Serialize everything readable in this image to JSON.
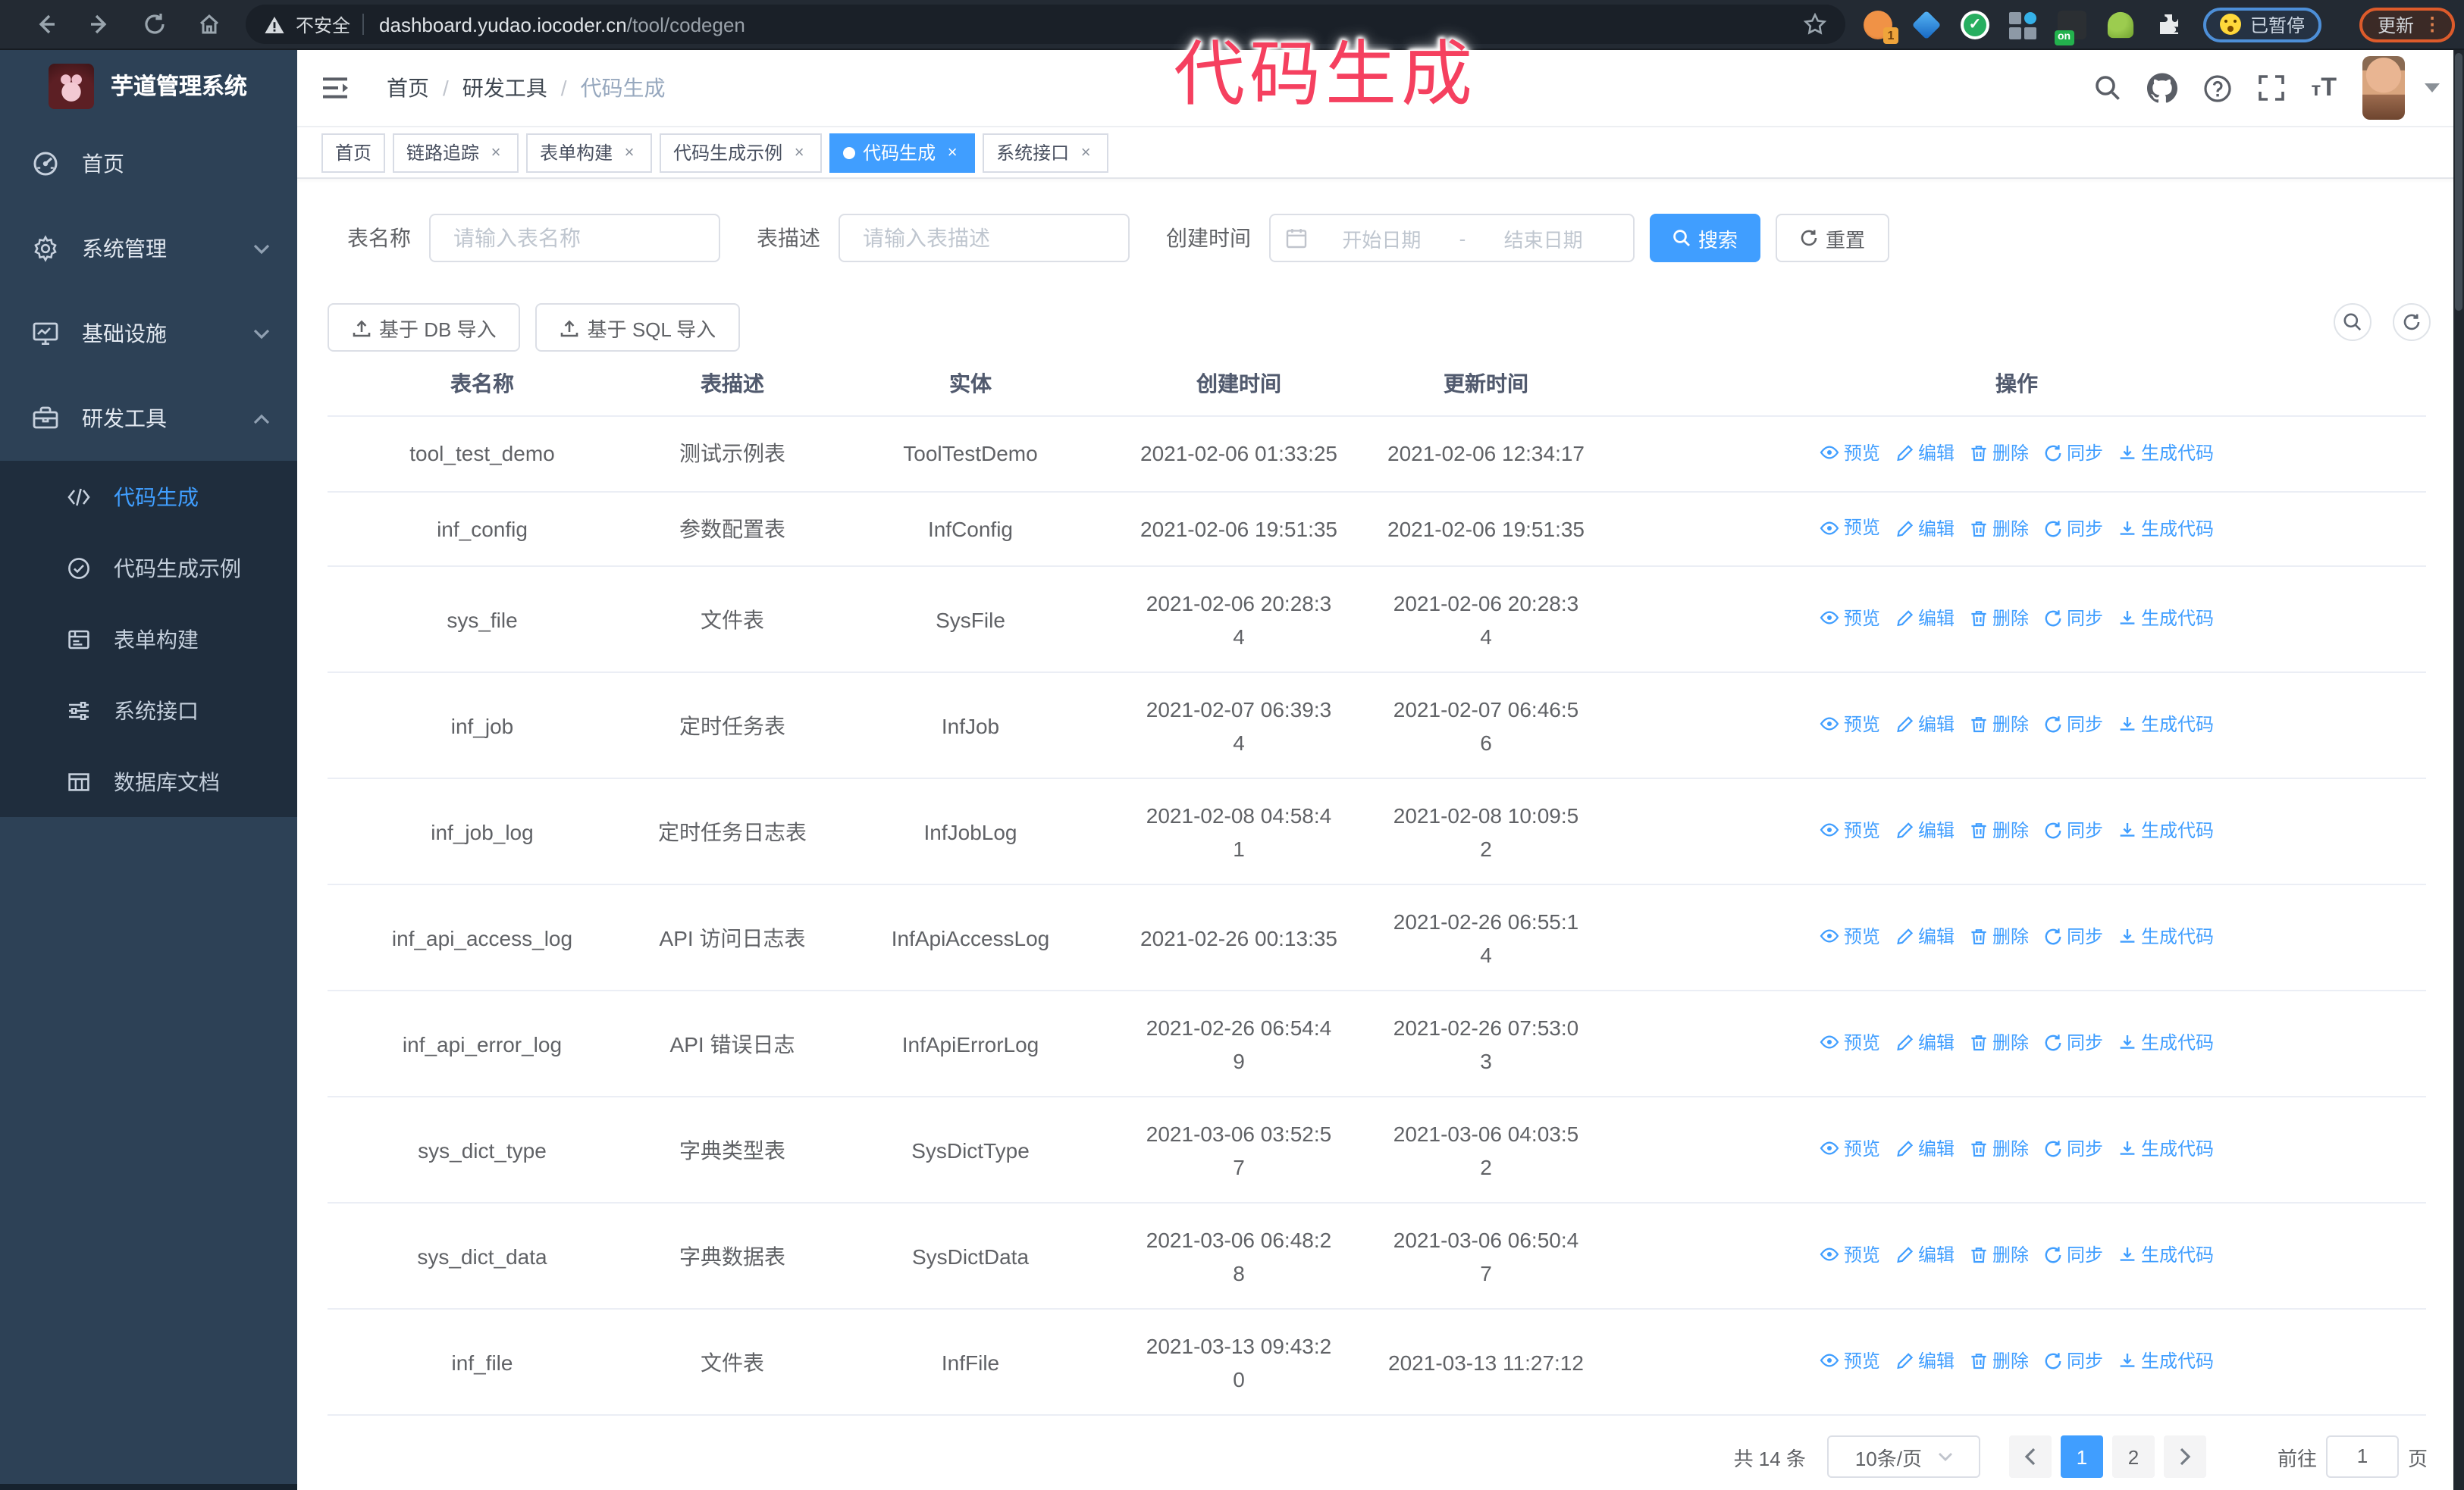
{
  "chrome": {
    "security_label": "不安全",
    "url_host": "dashboard.yudao.iocoder.cn",
    "url_path": "/tool/codegen",
    "paused_label": "已暂停",
    "update_label": "更新"
  },
  "annotation": "代码生成",
  "sidebar": {
    "logo_title": "芋道管理系统",
    "items": [
      {
        "label": "首页"
      },
      {
        "label": "系统管理"
      },
      {
        "label": "基础设施"
      },
      {
        "label": "研发工具"
      }
    ],
    "subitems": [
      {
        "label": "代码生成",
        "active": true
      },
      {
        "label": "代码生成示例"
      },
      {
        "label": "表单构建"
      },
      {
        "label": "系统接口"
      },
      {
        "label": "数据库文档"
      }
    ]
  },
  "navbar": {
    "breadcrumb": [
      "首页",
      "研发工具",
      "代码生成"
    ]
  },
  "tags": [
    {
      "label": "首页",
      "closable": false,
      "active": false
    },
    {
      "label": "链路追踪",
      "closable": true,
      "active": false
    },
    {
      "label": "表单构建",
      "closable": true,
      "active": false
    },
    {
      "label": "代码生成示例",
      "closable": true,
      "active": false
    },
    {
      "label": "代码生成",
      "closable": true,
      "active": true
    },
    {
      "label": "系统接口",
      "closable": true,
      "active": false
    }
  ],
  "filters": {
    "name_label": "表名称",
    "name_placeholder": "请输入表名称",
    "desc_label": "表描述",
    "desc_placeholder": "请输入表描述",
    "time_label": "创建时间",
    "start_placeholder": "开始日期",
    "range_separator": "-",
    "end_placeholder": "结束日期",
    "search_label": "搜索",
    "reset_label": "重置",
    "import_db_label": "基于 DB 导入",
    "import_sql_label": "基于 SQL 导入"
  },
  "table": {
    "columns": [
      "表名称",
      "表描述",
      "实体",
      "创建时间",
      "更新时间",
      "操作"
    ],
    "op_labels": {
      "preview": "预览",
      "edit": "编辑",
      "delete": "删除",
      "sync": "同步",
      "generate": "生成代码"
    },
    "rows": [
      {
        "name": "tool_test_demo",
        "desc": "测试示例表",
        "entity": "ToolTestDemo",
        "created": "2021-02-06 01:33:25",
        "updated": "2021-02-06 12:34:17"
      },
      {
        "name": "inf_config",
        "desc": "参数配置表",
        "entity": "InfConfig",
        "created": "2021-02-06 19:51:35",
        "updated": "2021-02-06 19:51:35"
      },
      {
        "name": "sys_file",
        "desc": "文件表",
        "entity": "SysFile",
        "created": "2021-02-06 20:28:3\n4",
        "updated": "2021-02-06 20:28:3\n4"
      },
      {
        "name": "inf_job",
        "desc": "定时任务表",
        "entity": "InfJob",
        "created": "2021-02-07 06:39:3\n4",
        "updated": "2021-02-07 06:46:5\n6"
      },
      {
        "name": "inf_job_log",
        "desc": "定时任务日志表",
        "entity": "InfJobLog",
        "created": "2021-02-08 04:58:4\n1",
        "updated": "2021-02-08 10:09:5\n2"
      },
      {
        "name": "inf_api_access_log",
        "desc": "API 访问日志表",
        "entity": "InfApiAccessLog",
        "created": "2021-02-26 00:13:35",
        "updated": "2021-02-26 06:55:1\n4"
      },
      {
        "name": "inf_api_error_log",
        "desc": "API 错误日志",
        "entity": "InfApiErrorLog",
        "created": "2021-02-26 06:54:4\n9",
        "updated": "2021-02-26 07:53:0\n3"
      },
      {
        "name": "sys_dict_type",
        "desc": "字典类型表",
        "entity": "SysDictType",
        "created": "2021-03-06 03:52:5\n7",
        "updated": "2021-03-06 04:03:5\n2"
      },
      {
        "name": "sys_dict_data",
        "desc": "字典数据表",
        "entity": "SysDictData",
        "created": "2021-03-06 06:48:2\n8",
        "updated": "2021-03-06 06:50:4\n7"
      },
      {
        "name": "inf_file",
        "desc": "文件表",
        "entity": "InfFile",
        "created": "2021-03-13 09:43:2\n0",
        "updated": "2021-03-13 11:27:12"
      }
    ]
  },
  "pagination": {
    "total_text": "共 14 条",
    "page_size": "10条/页",
    "pages": [
      "1",
      "2"
    ],
    "active_page": "1",
    "goto_label": "前往",
    "goto_value": "1",
    "page_label": "页"
  }
}
